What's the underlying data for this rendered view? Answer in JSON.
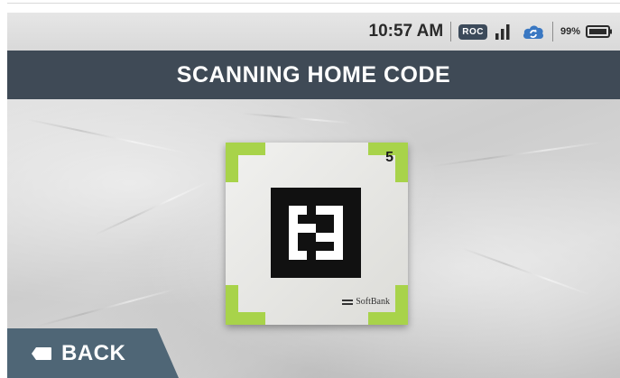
{
  "status_bar": {
    "time": "10:57 AM",
    "network_badge": "ROC",
    "battery_percent": "99%",
    "icons": [
      "signal-icon",
      "cloud-sync-icon",
      "battery-icon"
    ]
  },
  "header": {
    "title": "SCANNING HOME CODE"
  },
  "home_code": {
    "marker_number": "5",
    "brand_text": "SoftBank"
  },
  "back_button": {
    "label": "BACK",
    "icon": "back-tag-icon"
  },
  "colors": {
    "header_bg": "#3f4a56",
    "corner_accent": "#a8d34a",
    "back_button_bg": "#4f6676",
    "roc_badge_bg": "#3c4a5a",
    "cloud_icon": "#3a78c2"
  }
}
